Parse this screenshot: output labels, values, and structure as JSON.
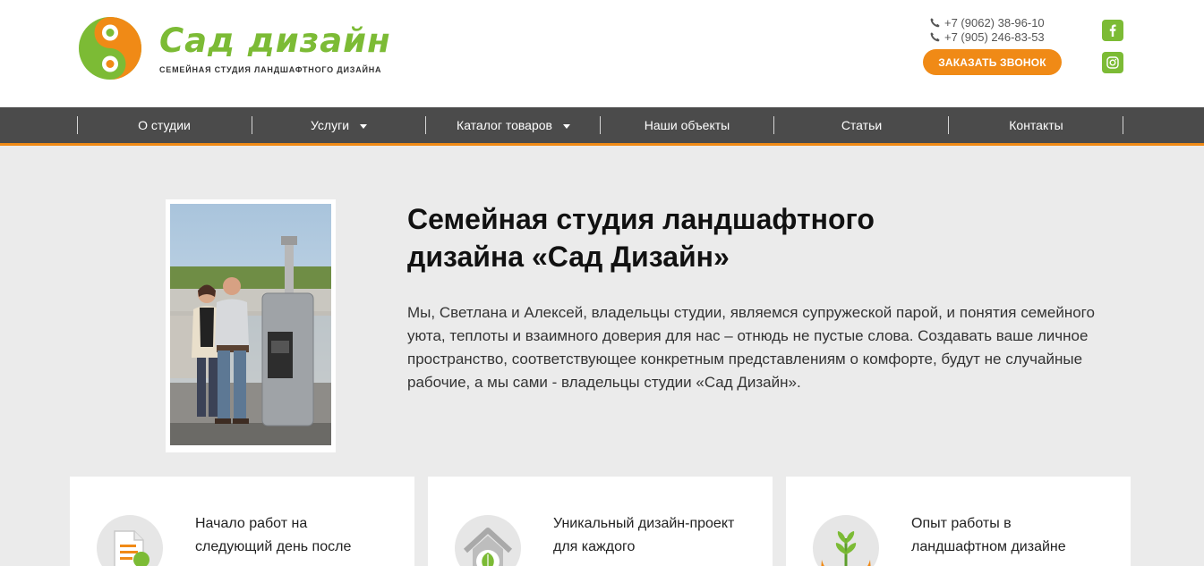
{
  "brand": {
    "name": "Сад дизайн",
    "tagline": "СЕМЕЙНАЯ СТУДИЯ ЛАНДШАФТНОГО ДИЗАЙНА",
    "logo_icon": "swirl-logo-icon",
    "green": "#7cbb35",
    "orange": "#f08a16"
  },
  "contacts": {
    "phones": [
      "+7 (9062) 38-96-10",
      "+7 (905) 246-83-53"
    ],
    "phone_icon": "phone-icon",
    "call_button": "ЗАКАЗАТЬ ЗВОНОК"
  },
  "social": {
    "facebook_icon": "facebook-icon",
    "instagram_icon": "instagram-icon"
  },
  "nav": {
    "items": [
      {
        "label": "О студии",
        "dropdown": false
      },
      {
        "label": "Услуги",
        "dropdown": true
      },
      {
        "label": "Каталог товаров",
        "dropdown": true
      },
      {
        "label": "Наши объекты",
        "dropdown": false
      },
      {
        "label": "Статьи",
        "dropdown": false
      },
      {
        "label": "Контакты",
        "dropdown": false
      }
    ],
    "background": "#4b4b4b",
    "accent_stripe": "#f08a16"
  },
  "hero": {
    "title": "Семейная студия ландшафтного дизайна «Сад Дизайн»",
    "text": "Мы, Светлана и Алексей, владельцы студии, являемся супружеской парой, и понятия семейного уюта, теплоты и взаимного доверия для нас – отнюдь не пустые слова. Создавать ваше личное пространство, соответствующее конкретным представлениям о комфорте, будут не случайные рабочие, а мы сами - владельцы студии «Сад Дизайн».",
    "photo": "owners-photo"
  },
  "features": [
    {
      "text": "Начало работ на следующий день после",
      "icon": "document-check-icon"
    },
    {
      "text": "Уникальный дизайн-проект для каждого",
      "icon": "house-leaf-icon"
    },
    {
      "text": "Опыт работы в ландшафтном дизайне",
      "icon": "hands-sprout-icon"
    }
  ]
}
